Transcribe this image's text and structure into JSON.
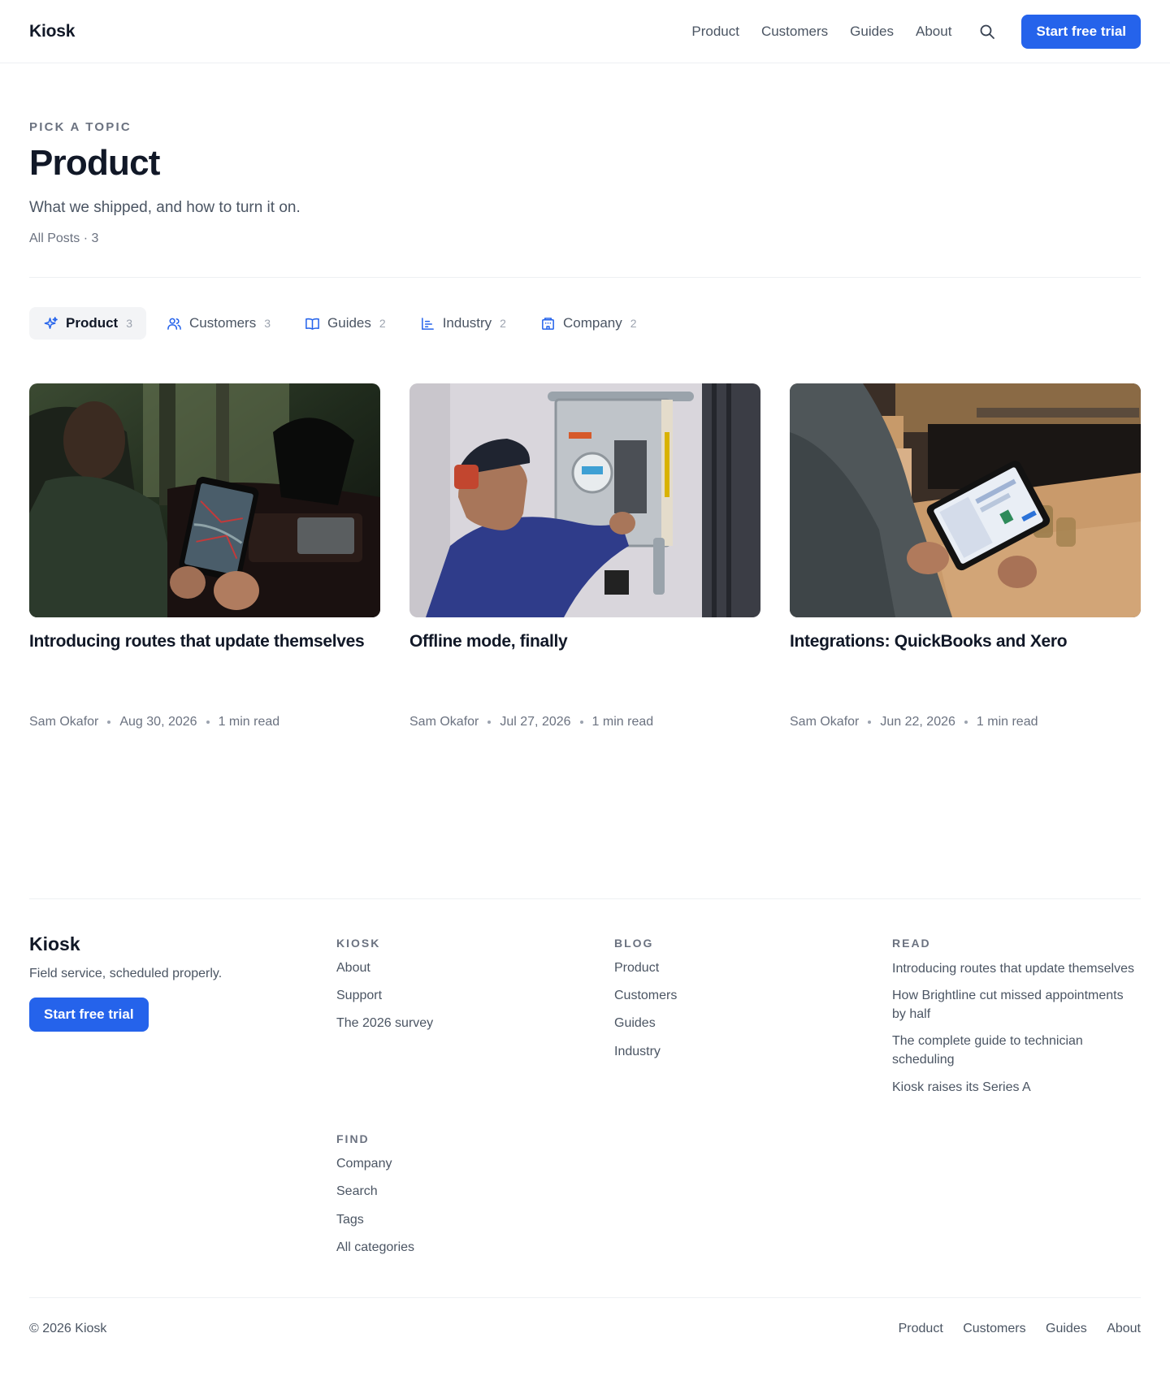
{
  "header": {
    "logo": "Kiosk",
    "nav": [
      "Product",
      "Customers",
      "Guides",
      "About"
    ],
    "cta": "Start free trial"
  },
  "hero": {
    "eyebrow": "PICK A TOPIC",
    "title": "Product",
    "description": "What we shipped, and how to turn it on.",
    "post_count": "All Posts · 3"
  },
  "tabs": [
    {
      "label": "Product",
      "count": "3",
      "icon": "sparkles-icon",
      "active": true
    },
    {
      "label": "Customers",
      "count": "3",
      "icon": "users-icon",
      "active": false
    },
    {
      "label": "Guides",
      "count": "2",
      "icon": "book-open-icon",
      "active": false
    },
    {
      "label": "Industry",
      "count": "2",
      "icon": "bar-chart-icon",
      "active": false
    },
    {
      "label": "Company",
      "count": "2",
      "icon": "building-icon",
      "active": false
    }
  ],
  "posts": [
    {
      "title": "Introducing routes that update themselves",
      "author": "Sam Okafor",
      "date": "Aug 30, 2026",
      "read": "1 min read",
      "image": "person-holding-tablet-with-map-in-truck"
    },
    {
      "title": "Offline mode, finally",
      "author": "Sam Okafor",
      "date": "Jul 27, 2026",
      "read": "1 min read",
      "image": "technician-working-on-electrical-meter"
    },
    {
      "title": "Integrations: QuickBooks and Xero",
      "author": "Sam Okafor",
      "date": "Jun 22, 2026",
      "read": "1 min read",
      "image": "hands-holding-tablet-at-counter"
    }
  ],
  "footer": {
    "logo": "Kiosk",
    "tagline": "Field service, scheduled properly.",
    "cta": "Start free trial",
    "columns": {
      "kiosk": {
        "heading": "KIOSK",
        "links": [
          "About",
          "Support",
          "The 2026 survey"
        ]
      },
      "blog": {
        "heading": "BLOG",
        "links": [
          "Product",
          "Customers",
          "Guides",
          "Industry"
        ]
      },
      "read": {
        "heading": "READ",
        "links": [
          "Introducing routes that update themselves",
          "How Brightline cut missed appointments by half",
          "The complete guide to technician scheduling",
          "Kiosk raises its Series A"
        ]
      },
      "find": {
        "heading": "FIND",
        "links": [
          "Company",
          "Search",
          "Tags",
          "All categories"
        ]
      }
    },
    "copyright": "© 2026 Kiosk",
    "bottom_nav": [
      "Product",
      "Customers",
      "Guides",
      "About"
    ]
  },
  "colors": {
    "accent": "#2563eb",
    "text": "#111827",
    "muted": "#6b7280"
  }
}
